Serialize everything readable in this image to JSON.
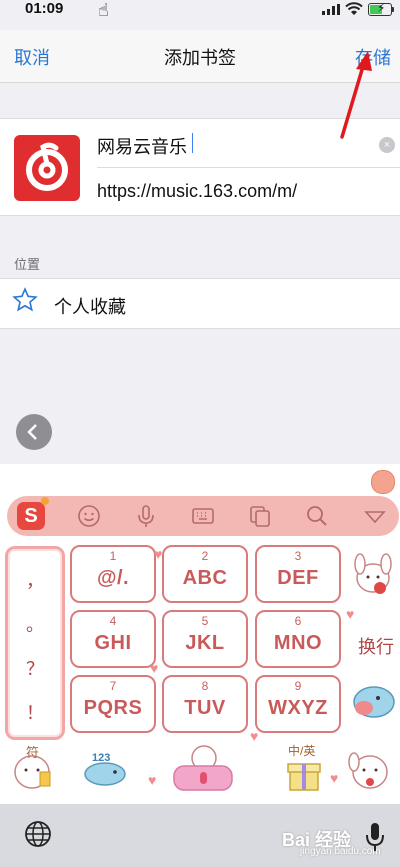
{
  "status_bar": {
    "time": "01:09"
  },
  "nav": {
    "cancel": "取消",
    "title": "添加书签",
    "save": "存储"
  },
  "bookmark": {
    "name": "网易云音乐",
    "url": "https://music.163.com/m/",
    "clear": "×"
  },
  "location": {
    "label": "位置",
    "folder": "个人收藏"
  },
  "keyboard": {
    "brand_letter": "S",
    "punctuation": [
      "，",
      "。",
      "？",
      "！"
    ],
    "keys": [
      {
        "num": "1",
        "label": "@/."
      },
      {
        "num": "2",
        "label": "ABC"
      },
      {
        "num": "3",
        "label": "DEF"
      },
      {
        "num": "4",
        "label": "GHI"
      },
      {
        "num": "5",
        "label": "JKL"
      },
      {
        "num": "6",
        "label": "MNO"
      },
      {
        "num": "7",
        "label": "PQRS"
      },
      {
        "num": "8",
        "label": "TUV"
      },
      {
        "num": "9",
        "label": "WXYZ"
      }
    ],
    "newline": "换行",
    "sticker_text_1": "符",
    "sticker_text_2": "123",
    "sticker_text_3": "中/英"
  },
  "watermark": {
    "logo": "Bai 经验",
    "sub": "jingyan.baidu.com"
  },
  "colors": {
    "accent": "#2a78d4",
    "app_red": "#e02d2f",
    "key_border": "#d97b7b",
    "toolbar_pink": "#f4b8b4",
    "arrow_red": "#e0191f"
  }
}
